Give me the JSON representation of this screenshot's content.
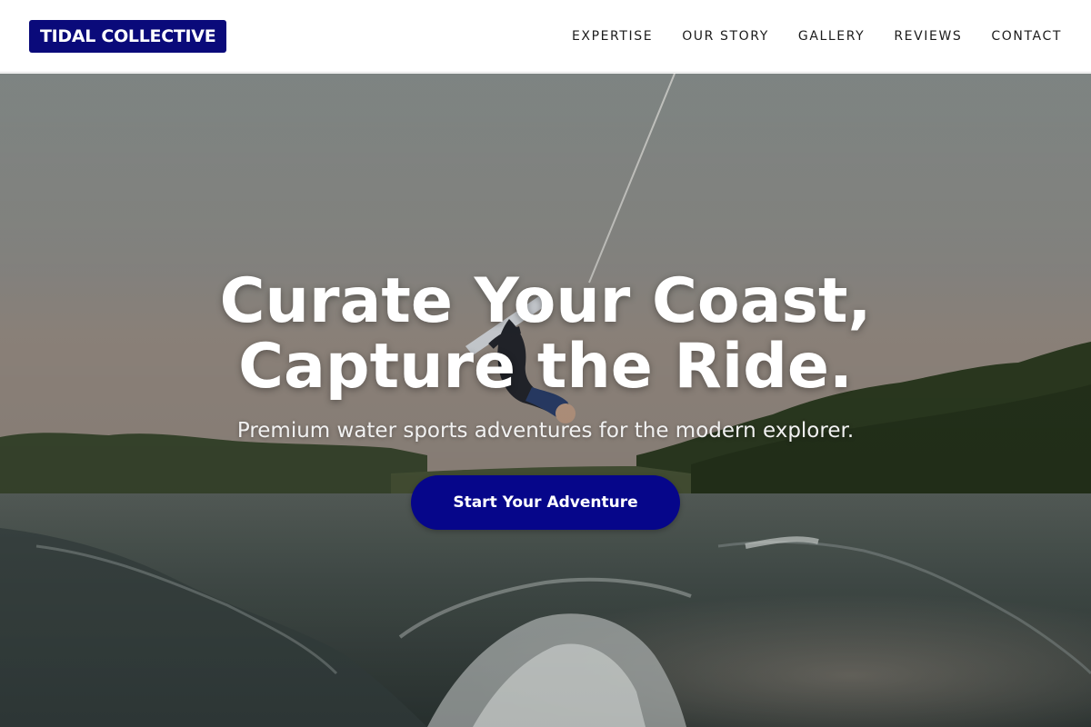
{
  "brand": {
    "logo_text": "TIDAL COLLECTIVE",
    "accent_color": "#0a0a7a"
  },
  "nav": {
    "items": [
      {
        "label": "EXPERTISE"
      },
      {
        "label": "OUR STORY"
      },
      {
        "label": "GALLERY"
      },
      {
        "label": "REVIEWS"
      },
      {
        "label": "CONTACT"
      }
    ]
  },
  "hero": {
    "title_line1": "Curate Your Coast,",
    "title_line2": "Capture the Ride.",
    "subtitle": "Premium water sports adventures for the modern explorer.",
    "cta_label": "Start Your Adventure",
    "cta_color": "#06068a",
    "background_image": "wakeboarder-flip-over-lake-photo"
  }
}
